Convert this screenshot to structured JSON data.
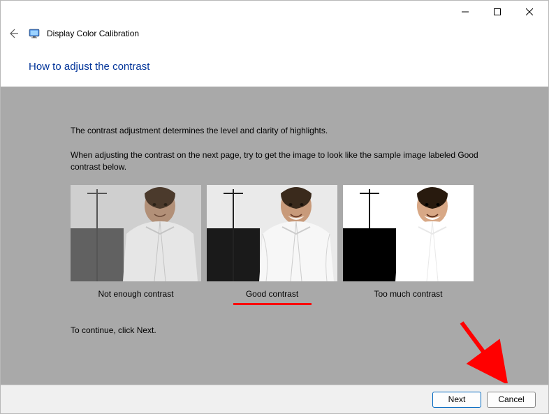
{
  "window": {
    "app_name": "Display Color Calibration"
  },
  "page": {
    "heading": "How to adjust the contrast",
    "paragraph1": "The contrast adjustment determines the level and clarity of highlights.",
    "paragraph2": "When adjusting the contrast on the next page, try to get the image to look like the sample image labeled Good contrast below.",
    "continue_text": "To continue, click Next."
  },
  "samples": {
    "low": "Not enough contrast",
    "good": "Good contrast",
    "high": "Too much contrast"
  },
  "buttons": {
    "next": "Next",
    "cancel": "Cancel"
  }
}
